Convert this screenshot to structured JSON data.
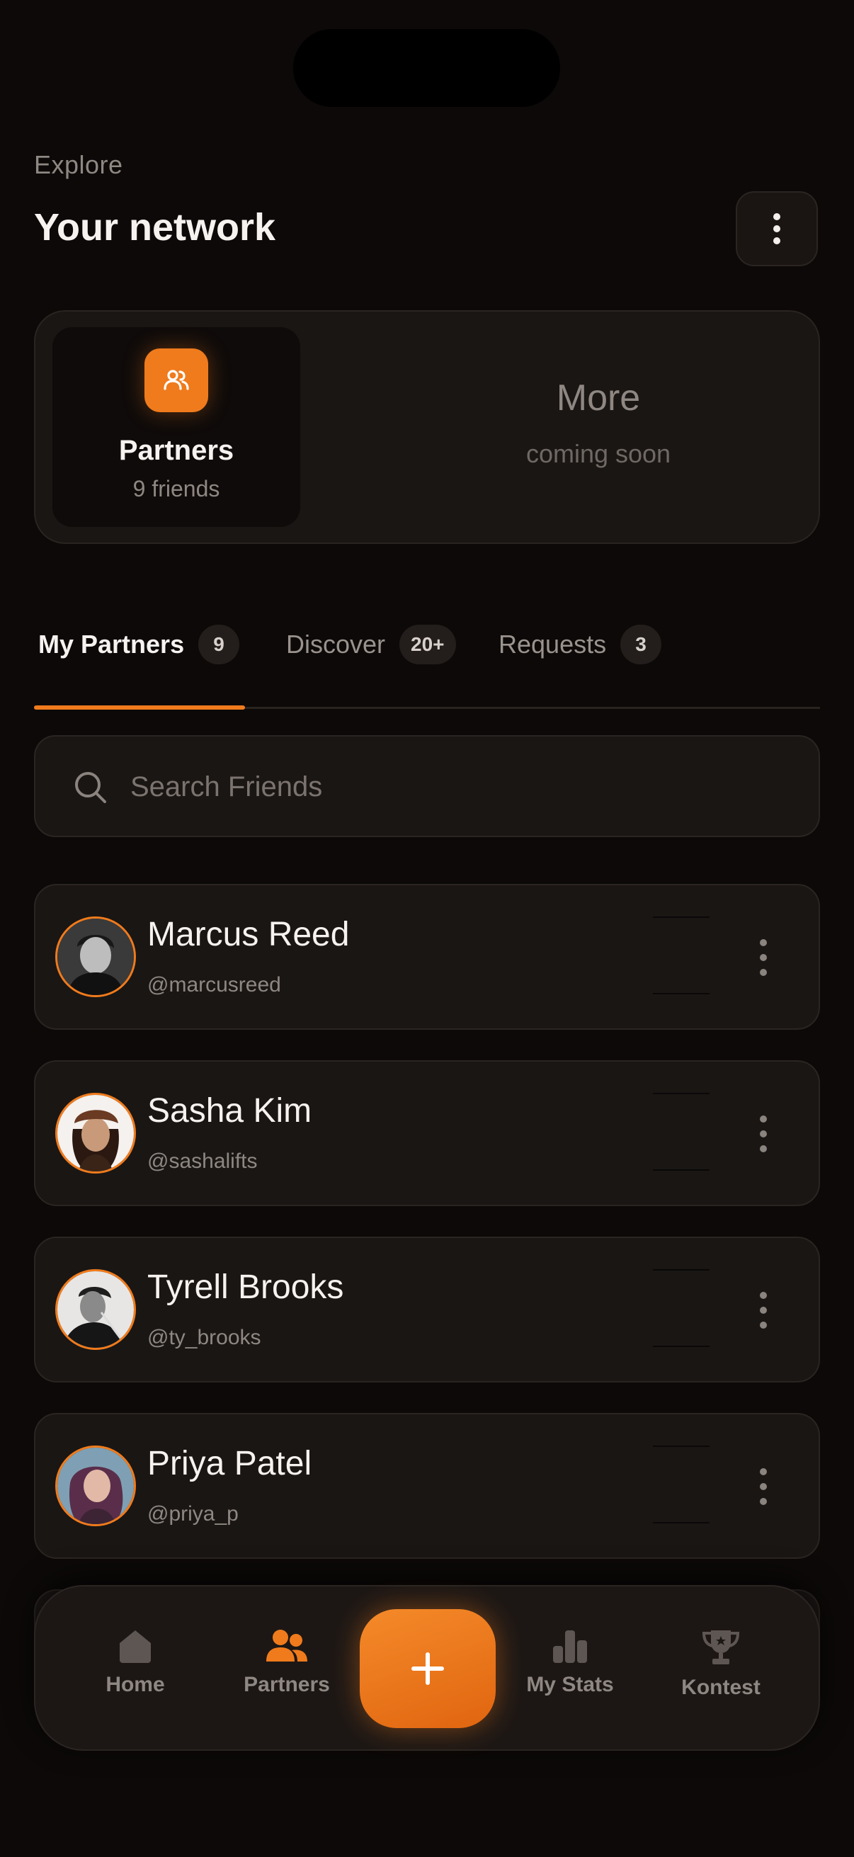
{
  "header": {
    "eyebrow": "Explore",
    "title": "Your network"
  },
  "segment": {
    "active": {
      "label": "Partners",
      "sub": "9 friends",
      "icon": "people-icon"
    },
    "more": {
      "label": "More",
      "sub": "coming soon"
    }
  },
  "tabs": [
    {
      "label": "My Partners",
      "badge": "9",
      "active": true
    },
    {
      "label": "Discover",
      "badge": "20+",
      "active": false
    },
    {
      "label": "Requests",
      "badge": "3",
      "active": false
    }
  ],
  "search": {
    "placeholder": "Search Friends"
  },
  "friends": [
    {
      "name": "Marcus Reed",
      "handle": "@marcusreed"
    },
    {
      "name": "Sasha Kim",
      "handle": "@sashalifts"
    },
    {
      "name": "Tyrell Brooks",
      "handle": "@ty_brooks"
    },
    {
      "name": "Priya Patel",
      "handle": "@priya_p"
    }
  ],
  "nav": {
    "items": [
      {
        "label": "Home",
        "icon": "home-icon"
      },
      {
        "label": "Partners",
        "icon": "partners-icon",
        "active": true
      },
      {
        "label": "My Stats",
        "icon": "stats-icon"
      },
      {
        "label": "Kontest",
        "icon": "trophy-icon"
      }
    ],
    "fab_icon": "plus-icon"
  },
  "colors": {
    "accent": "#f07b1c",
    "background": "#0c0908",
    "card": "#1a1614"
  }
}
